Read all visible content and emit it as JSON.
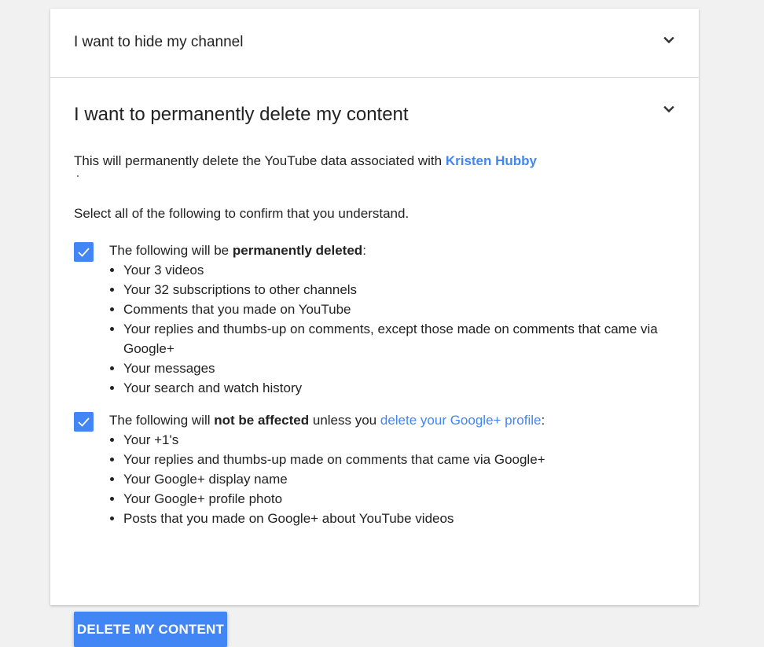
{
  "sections": {
    "hide": {
      "title": "I want to hide my channel",
      "icon": "chevron-down-icon"
    },
    "delete": {
      "title": "I want to permanently delete my content",
      "icon": "chevron-down-icon",
      "intro_text": "This will permanently delete the YouTube data associated with ",
      "channel_name": "Kristen Hubby",
      "confirm_text": "Select all of the following to confirm that you understand.",
      "group1": {
        "checked": true,
        "lead_text": "The following will be ",
        "lead_bold": "permanently deleted",
        "lead_tail": ":",
        "items": [
          "Your 3 videos",
          "Your 32 subscriptions to other channels",
          "Comments that you made on YouTube",
          "Your replies and thumbs-up on comments, except those made on comments that came via Google+",
          "Your messages",
          "Your search and watch history"
        ]
      },
      "group2": {
        "checked": true,
        "lead_text": "The following will ",
        "lead_bold": "not be affected",
        "lead_mid": " unless you ",
        "lead_link": "delete your Google+ profile",
        "lead_tail": ":",
        "items": [
          "Your +1's",
          "Your replies and thumbs-up made on comments that came via Google+",
          "Your Google+ display name",
          "Your Google+ profile photo",
          "Posts that you made on Google+ about YouTube videos"
        ]
      },
      "button_label": "DELETE MY CONTENT"
    }
  },
  "colors": {
    "accent": "#4285f4",
    "background": "#f1f1f1",
    "card": "#ffffff"
  }
}
